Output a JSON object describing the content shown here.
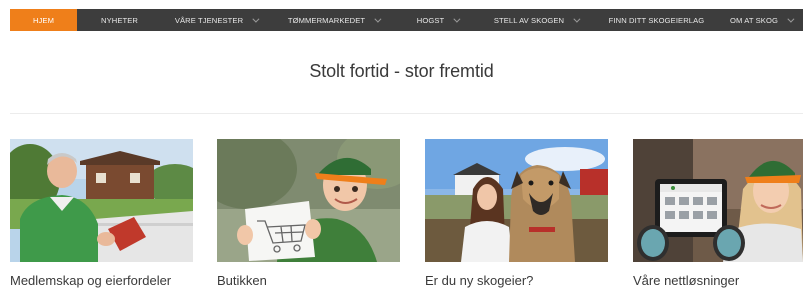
{
  "nav": {
    "items": [
      {
        "label": "HJEM",
        "active": true,
        "has_dropdown": false
      },
      {
        "label": "NYHETER",
        "active": false,
        "has_dropdown": false
      },
      {
        "label": "VÅRE TJENESTER",
        "active": false,
        "has_dropdown": true
      },
      {
        "label": "TØMMERMARKEDET",
        "active": false,
        "has_dropdown": true
      },
      {
        "label": "HOGST",
        "active": false,
        "has_dropdown": true
      },
      {
        "label": "STELL AV SKOGEN",
        "active": false,
        "has_dropdown": true
      },
      {
        "label": "FINN DITT SKOGEIERLAG",
        "active": false,
        "has_dropdown": false
      },
      {
        "label": "OM AT SKOG",
        "active": false,
        "has_dropdown": true
      }
    ]
  },
  "headline": "Stolt fortid - stor fremtid",
  "cards": [
    {
      "caption": "Medlemskap og eierfordeler",
      "image": "man-with-tablet-outdoors"
    },
    {
      "caption": "Butikken",
      "image": "boy-holding-cart-drawing"
    },
    {
      "caption": "Er du ny skogeier?",
      "image": "girl-with-great-dane"
    },
    {
      "caption": "Våre nettløsninger",
      "image": "girl-with-tablet-app"
    }
  ],
  "colors": {
    "nav_bg": "#3d3d3d",
    "nav_active": "#ef7f1a",
    "nav_text": "#e8e8e8",
    "brand_green": "#3a8d3a"
  }
}
